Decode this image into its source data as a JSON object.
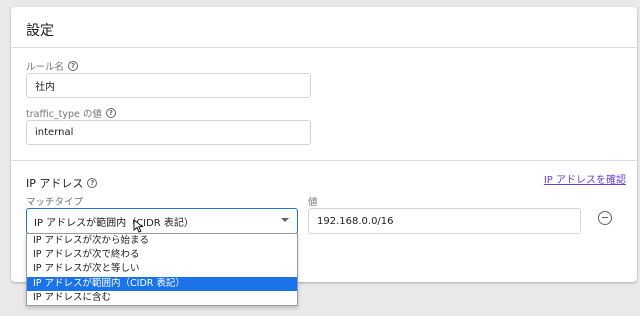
{
  "card": {
    "title": "設定",
    "rule_name": {
      "label": "ルール名",
      "value": "社内"
    },
    "traffic_type": {
      "label": "traffic_type の値",
      "value": "internal"
    },
    "ip_section": {
      "title": "IP アドレス",
      "confirm_link": "IP アドレスを確認",
      "match_type": {
        "label": "マッチタイプ",
        "selected": "IP アドレスが範囲内（CIDR 表記）",
        "options": [
          "IP アドレスが次から始まる",
          "IP アドレスが次で終わる",
          "IP アドレスが次と等しい",
          "IP アドレスが範囲内（CIDR 表記）",
          "IP アドレスに含む"
        ],
        "highlighted_index": 3
      },
      "value": {
        "label": "値",
        "value": "192.168.0.0/16"
      }
    }
  },
  "colors": {
    "accent": "#1a73e8",
    "link": "#6a3fd6"
  }
}
